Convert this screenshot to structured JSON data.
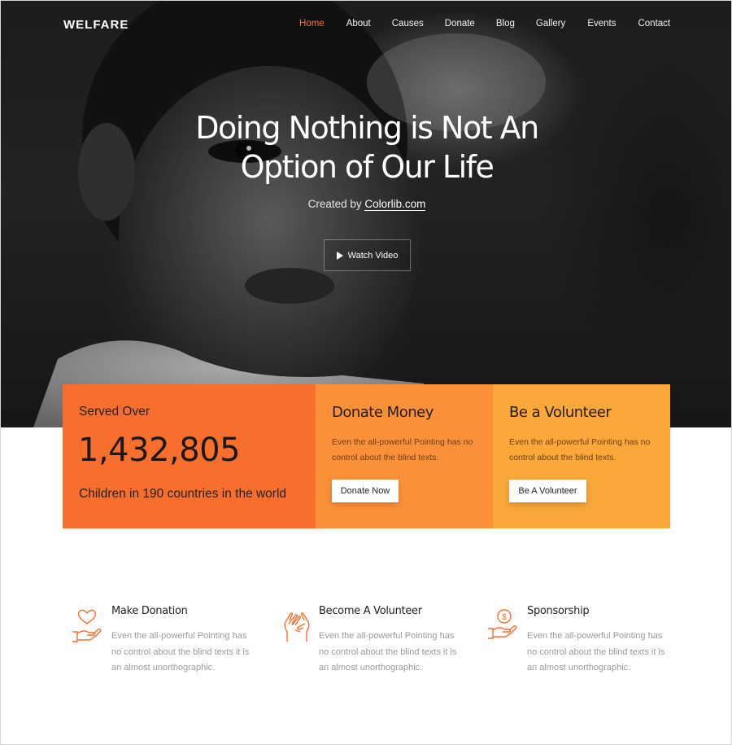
{
  "brand": "WELFARE",
  "nav": [
    {
      "label": "Home",
      "active": true
    },
    {
      "label": "About",
      "active": false
    },
    {
      "label": "Causes",
      "active": false
    },
    {
      "label": "Donate",
      "active": false
    },
    {
      "label": "Blog",
      "active": false
    },
    {
      "label": "Gallery",
      "active": false
    },
    {
      "label": "Events",
      "active": false
    },
    {
      "label": "Contact",
      "active": false
    }
  ],
  "hero": {
    "title_line1": "Doing Nothing is Not An",
    "title_line2": "Option of Our Life",
    "created_prefix": "Created by",
    "created_link": "Colorlib.com",
    "watch_label": "Watch Video"
  },
  "stats": {
    "label": "Served Over",
    "number": "1,432,805",
    "desc": "Children in 190 countries in the world"
  },
  "donate": {
    "title": "Donate Money",
    "text": "Even the all-powerful Pointing has no control about the blind texts.",
    "button": "Donate Now"
  },
  "volunteer": {
    "title": "Be a Volunteer",
    "text": "Even the all-powerful Pointing has no control about the blind texts.",
    "button": "Be A Volunteer"
  },
  "services": [
    {
      "title": "Make Donation",
      "icon": "heart-hand-icon",
      "text": "Even the all-powerful Pointing has no control about the blind texts it is an almost unorthographic."
    },
    {
      "title": "Become A Volunteer",
      "icon": "hands-icon",
      "text": "Even the all-powerful Pointing has no control about the blind texts it is an almost unorthographic."
    },
    {
      "title": "Sponsorship",
      "icon": "coin-hand-icon",
      "text": "Even the all-powerful Pointing has no control about the blind texts it is an almost unorthographic."
    }
  ],
  "colors": {
    "accent": "#f86f2d",
    "orange_mid": "#fa913a",
    "orange_light": "#fba83a"
  }
}
